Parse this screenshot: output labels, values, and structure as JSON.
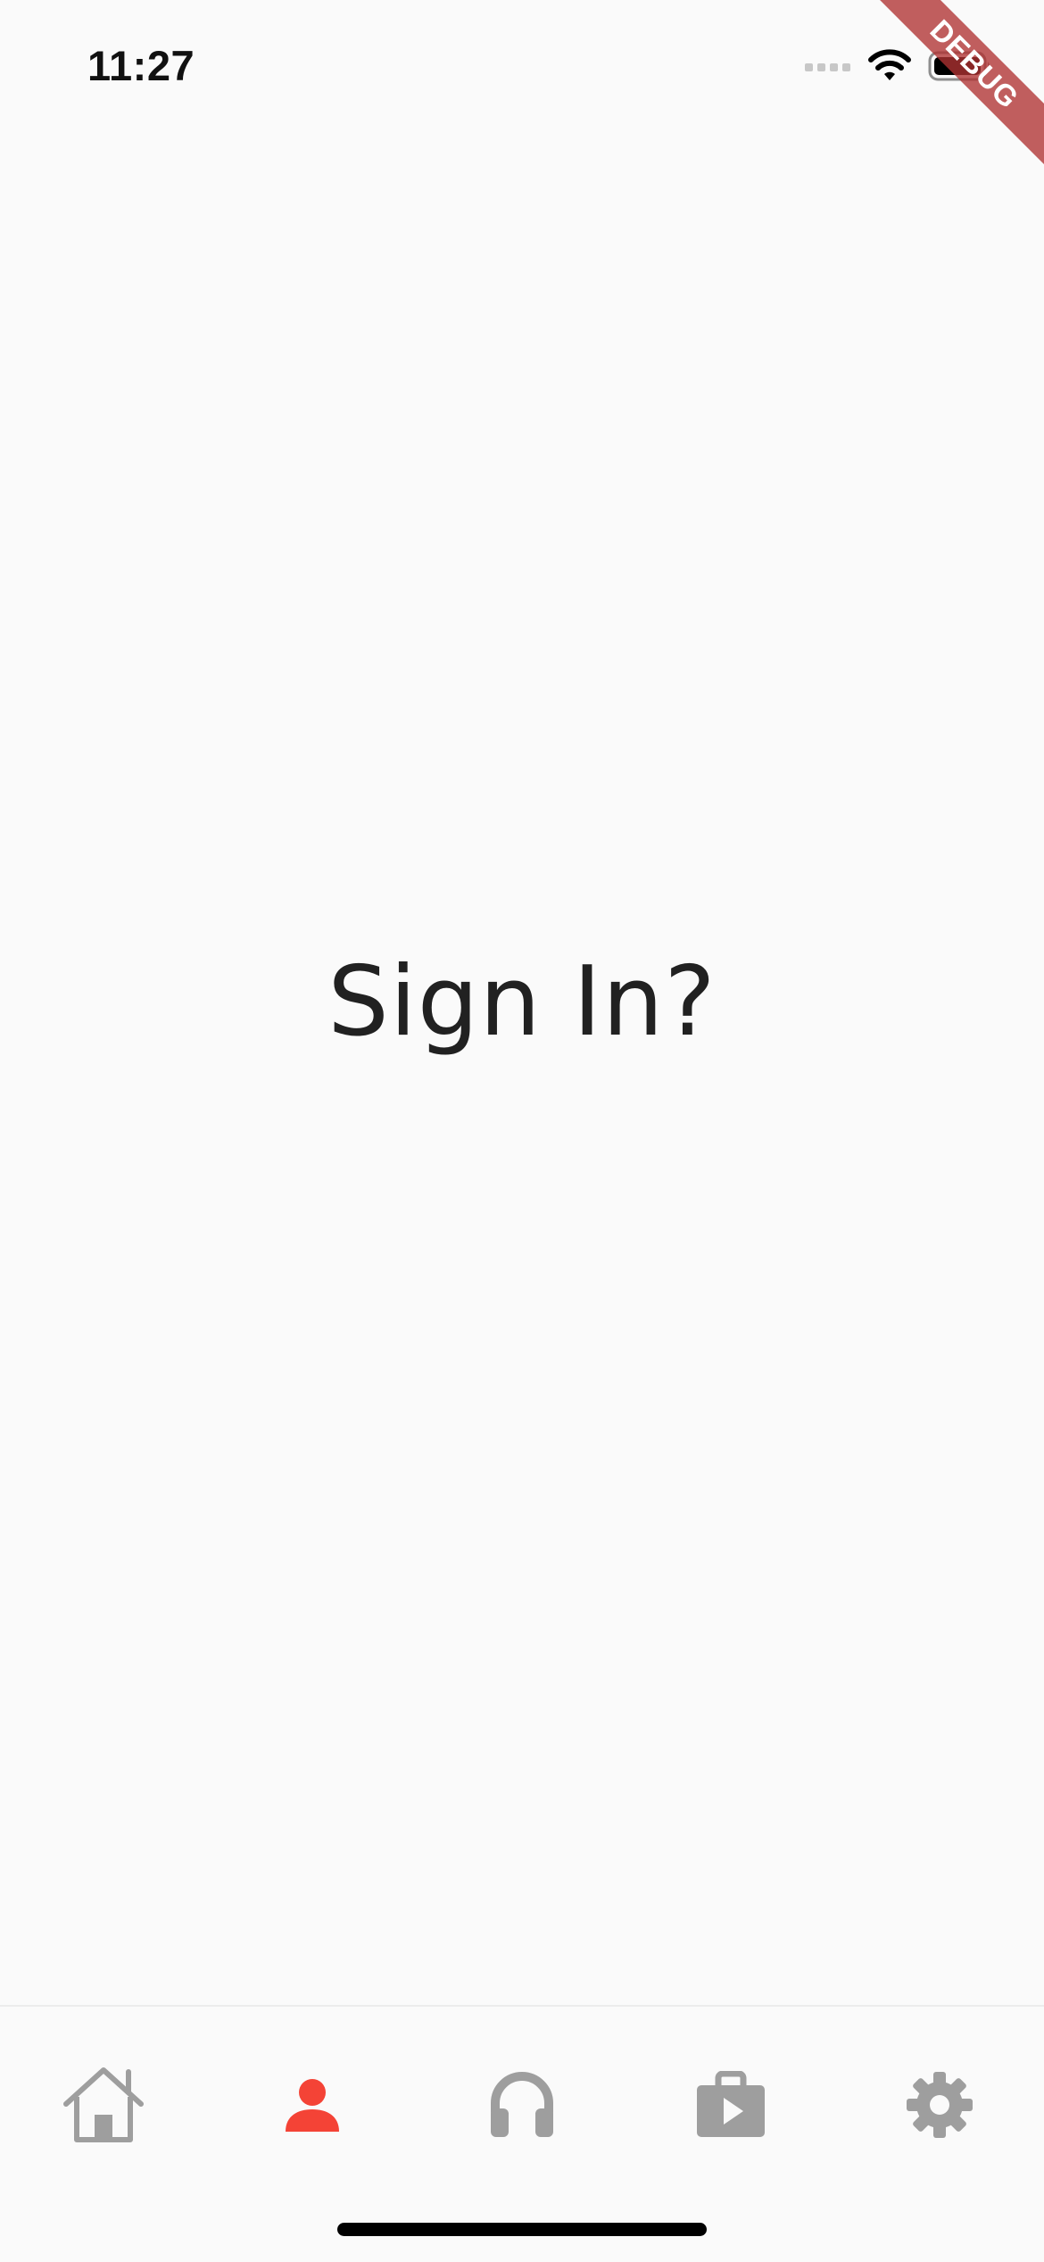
{
  "status_bar": {
    "time": "11:27",
    "icons": [
      "cellular-signal-icon",
      "wifi-icon",
      "battery-icon"
    ]
  },
  "debug_banner": "DEBUG",
  "main": {
    "title": "Sign In?"
  },
  "bottom_nav": {
    "active_color": "#f44336",
    "inactive_color": "#9e9e9e",
    "items": [
      {
        "icon": "home-icon",
        "active": false
      },
      {
        "icon": "person-icon",
        "active": true
      },
      {
        "icon": "headphones-icon",
        "active": false
      },
      {
        "icon": "video-library-icon",
        "active": false
      },
      {
        "icon": "gear-icon",
        "active": false
      }
    ]
  }
}
